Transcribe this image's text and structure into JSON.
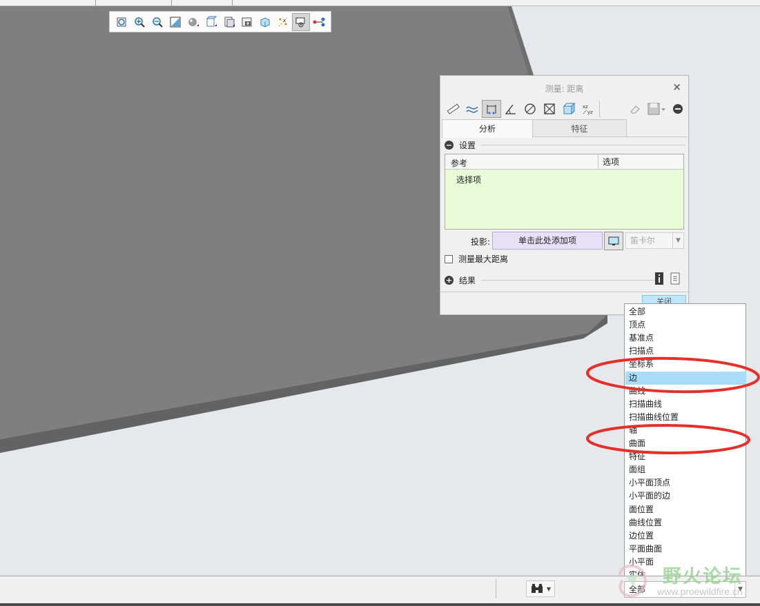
{
  "measure_dialog": {
    "title": "测量: 距离",
    "close_glyph": "×",
    "tabs": [
      "分析",
      "特征"
    ],
    "settings_label": "设置",
    "ref_column": "参考",
    "options_column": "选项",
    "select_prompt": "选择项",
    "projection_label": "投影:",
    "projection_placeholder": "单击此处添加项",
    "coord_system": "笛卡尔",
    "max_distance_label": "测量最大距离",
    "results_label": "结果",
    "close_button": "关闭"
  },
  "filter_dropdown": {
    "items": [
      "全部",
      "顶点",
      "基准点",
      "扫描点",
      "坐标系",
      "边",
      "曲线",
      "扫描曲线",
      "扫描曲线位置",
      "轴",
      "曲面",
      "特征",
      "面组",
      "小平面顶点",
      "小平面的边",
      "面位置",
      "曲线位置",
      "边位置",
      "平面曲面",
      "小平面",
      "实体"
    ],
    "selected": "边",
    "current_value": "全部"
  },
  "status_bar": {
    "find_label": "查找"
  },
  "watermark": {
    "name": "野火论坛",
    "url": "www.proewildfire.cn"
  },
  "colors": {
    "model_top": "#7f7f7f",
    "model_edge": "#636363",
    "background": "#e6e8ec",
    "selection": "#a8dcf7",
    "annotation": "#e5302a",
    "reference_area": "#e8fad8",
    "projection_field": "#e7e0f6"
  }
}
